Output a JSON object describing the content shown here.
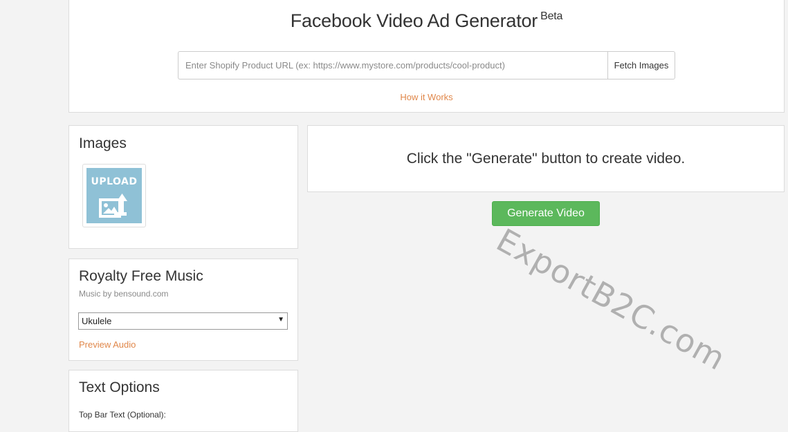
{
  "header": {
    "title": "Facebook Video Ad Generator",
    "badge": "Beta",
    "url_placeholder": "Enter Shopify Product URL (ex: https://www.mystore.com/products/cool-product)",
    "url_value": "",
    "fetch_label": "Fetch Images",
    "how_link": "How it Works"
  },
  "images": {
    "heading": "Images",
    "upload_label": "UPLOAD",
    "upload_icon": "image-upload-icon"
  },
  "music": {
    "heading": "Royalty Free Music",
    "credit": "Music by bensound.com",
    "selected": "Ukulele",
    "preview_link": "Preview Audio"
  },
  "text_options": {
    "heading": "Text Options",
    "top_bar_label": "Top Bar Text (Optional):"
  },
  "video": {
    "message": "Click the \"Generate\" button to create video.",
    "generate_label": "Generate Video"
  },
  "watermark": "ExportB2C.com",
  "colors": {
    "accent_link": "#e0874a",
    "generate_green": "#5cb85c",
    "upload_tile": "#8fc1d6",
    "background": "#f3f3f3"
  }
}
